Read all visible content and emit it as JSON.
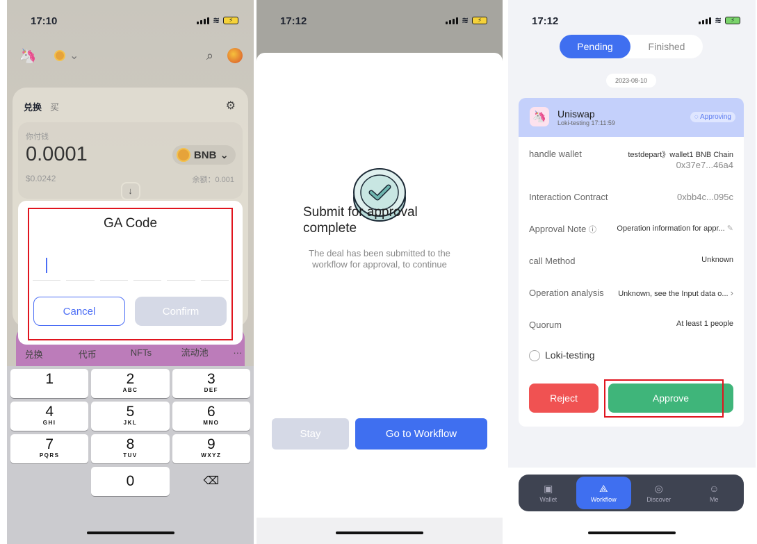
{
  "phone1": {
    "status": {
      "time": "17:10"
    },
    "swap": {
      "tab_active": "兑换",
      "tab_other": "买",
      "pay_label": "你付钱",
      "pay_value": "0.0001",
      "token": "BNB",
      "usd_value": "$0.0242",
      "balance": "余额：0.001"
    },
    "modal": {
      "title": "GA Code",
      "cancel": "Cancel",
      "confirm": "Confirm"
    },
    "tabs": [
      "兑换",
      "代币",
      "NFTs",
      "流动池"
    ],
    "more": "···",
    "keypad": [
      [
        {
          "n": "1",
          "l": ""
        },
        {
          "n": "2",
          "l": "ABC"
        },
        {
          "n": "3",
          "l": "DEF"
        }
      ],
      [
        {
          "n": "4",
          "l": "GHI"
        },
        {
          "n": "5",
          "l": "JKL"
        },
        {
          "n": "6",
          "l": "MNO"
        }
      ],
      [
        {
          "n": "7",
          "l": "PQRS"
        },
        {
          "n": "8",
          "l": "TUV"
        },
        {
          "n": "9",
          "l": "WXYZ"
        }
      ]
    ],
    "zero": "0"
  },
  "phone2": {
    "status": {
      "time": "17:12"
    },
    "title": "Submit for approval complete",
    "description": "The deal has been submitted to the workflow for approval, to continue",
    "stay": "Stay",
    "go": "Go to Workflow"
  },
  "phone3": {
    "status": {
      "time": "17:12"
    },
    "seg_pending": "Pending",
    "seg_finished": "Finished",
    "date": "2023-08-10",
    "card": {
      "name": "Uniswap",
      "sub": "Loki-testing 17:11:59",
      "badge": "Approving",
      "rows": [
        {
          "k": "handle wallet",
          "v1": "testdepart》wallet1 BNB Chain",
          "v2": "0x37e7...46a4"
        },
        {
          "k": "Interaction Contract",
          "v1": "0xbb4c...095c"
        },
        {
          "k": "Approval Note",
          "v1": "Operation information for appr..."
        },
        {
          "k": "call Method",
          "v1": "Unknown"
        },
        {
          "k": "Operation analysis",
          "v1": "Unknown, see the Input data o..."
        },
        {
          "k": "Quorum",
          "v1": "At least 1 people"
        }
      ],
      "approver": "Loki-testing",
      "reject": "Reject",
      "approve": "Approve"
    },
    "tabs": [
      {
        "label": "Wallet",
        "icon": "wallet-icon"
      },
      {
        "label": "Workflow",
        "icon": "workflow-icon"
      },
      {
        "label": "Discover",
        "icon": "compass-icon"
      },
      {
        "label": "Me",
        "icon": "face-icon"
      }
    ]
  },
  "colors": {
    "accent": "#3f6ff0",
    "approve": "#3fb57a",
    "reject": "#f05252",
    "highlight": "#e0141e"
  }
}
